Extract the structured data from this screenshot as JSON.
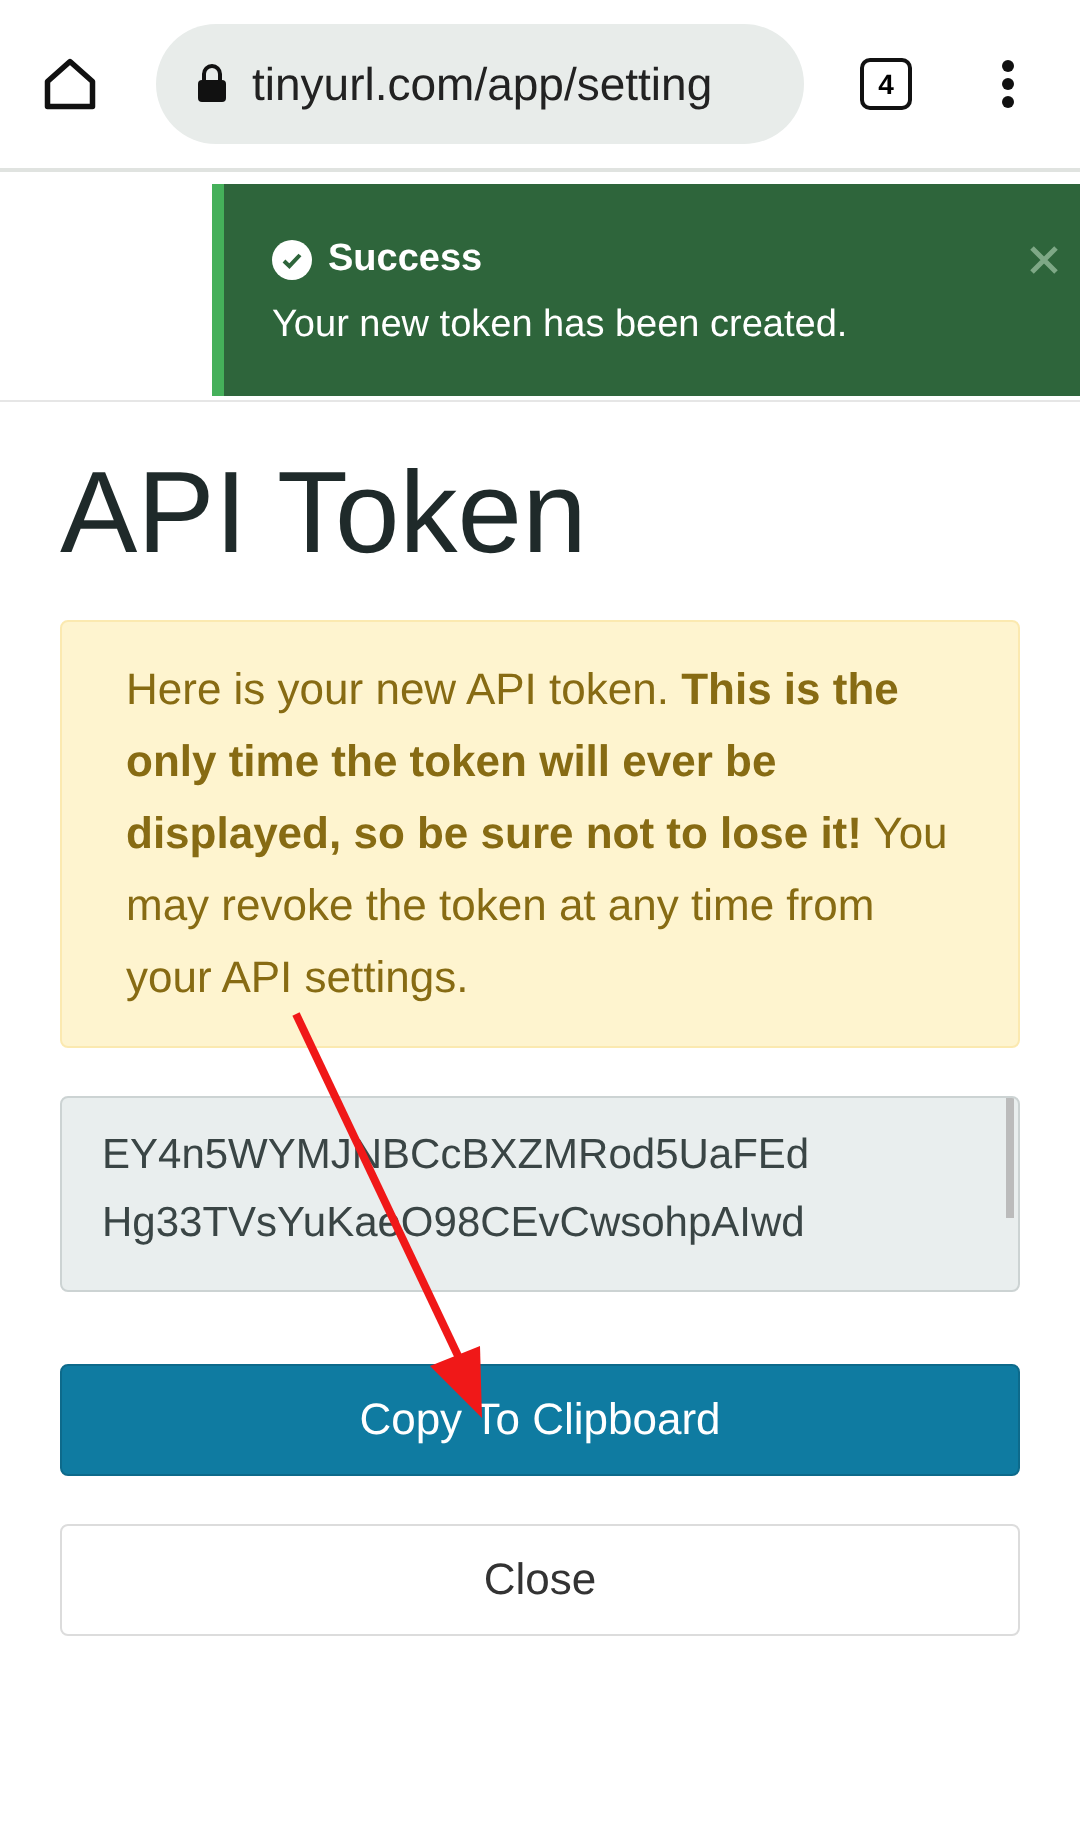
{
  "browser": {
    "url": "tinyurl.com/app/setting",
    "tab_count": "4"
  },
  "toast": {
    "title": "Success",
    "message": "Your new token has been created."
  },
  "page": {
    "title": "API Token",
    "notice": "Here is your new API token. **This is the only time the token will ever be displayed, so be sure not to lose it!** You may revoke the token at any time from your API settings.",
    "token_lines": [
      "EY4n5WYMJNBCcBXZMRod5UaFEd",
      "Hg33TVsYuKaeO98CEvCwsohpAIwd"
    ],
    "buttons": [
      {
        "label": "Copy To Clipboard",
        "kind": "primary"
      },
      {
        "label": "Close",
        "kind": "secondary"
      }
    ]
  }
}
